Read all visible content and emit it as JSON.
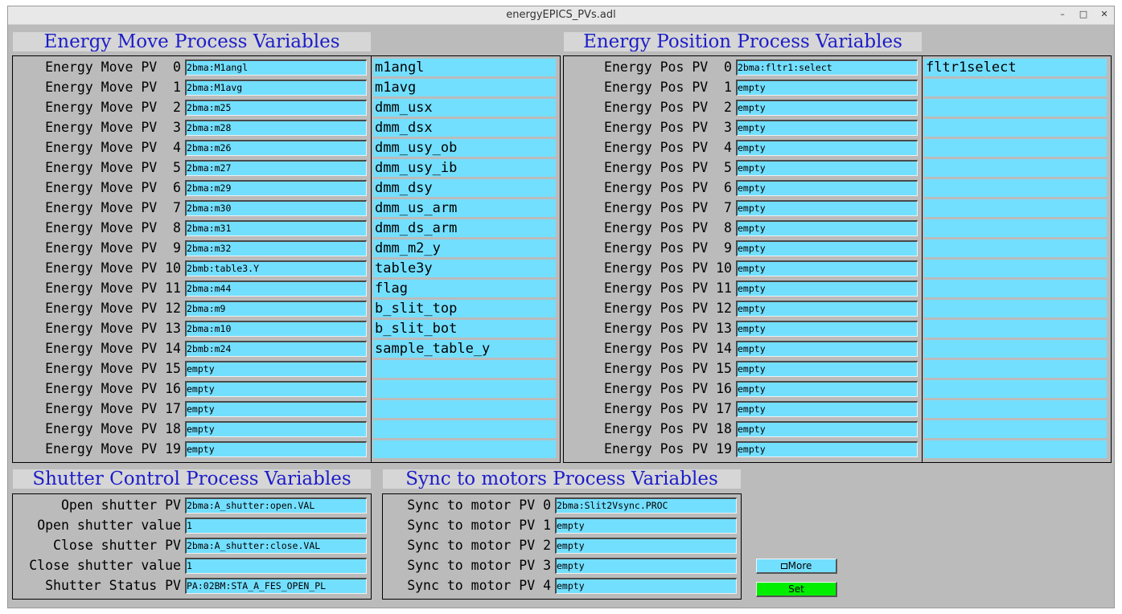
{
  "window": {
    "title": "energyEPICS_PVs.adl",
    "minimize": "–",
    "maximize": "□",
    "close": "✕"
  },
  "move": {
    "title": "Energy Move Process Variables",
    "rows": [
      {
        "label": "Energy Move PV  0",
        "pv": "2bma:M1angl",
        "desc": "m1angl"
      },
      {
        "label": "Energy Move PV  1",
        "pv": "2bma:M1avg",
        "desc": "m1avg"
      },
      {
        "label": "Energy Move PV  2",
        "pv": "2bma:m25",
        "desc": "dmm_usx"
      },
      {
        "label": "Energy Move PV  3",
        "pv": "2bma:m28",
        "desc": "dmm_dsx"
      },
      {
        "label": "Energy Move PV  4",
        "pv": "2bma:m26",
        "desc": "dmm_usy_ob"
      },
      {
        "label": "Energy Move PV  5",
        "pv": "2bma:m27",
        "desc": "dmm_usy_ib"
      },
      {
        "label": "Energy Move PV  6",
        "pv": "2bma:m29",
        "desc": "dmm_dsy"
      },
      {
        "label": "Energy Move PV  7",
        "pv": "2bma:m30",
        "desc": "dmm_us_arm"
      },
      {
        "label": "Energy Move PV  8",
        "pv": "2bma:m31",
        "desc": "dmm_ds_arm"
      },
      {
        "label": "Energy Move PV  9",
        "pv": "2bma:m32",
        "desc": "dmm_m2_y"
      },
      {
        "label": "Energy Move PV 10",
        "pv": "2bmb:table3.Y",
        "desc": "table3y"
      },
      {
        "label": "Energy Move PV 11",
        "pv": "2bma:m44",
        "desc": "flag"
      },
      {
        "label": "Energy Move PV 12",
        "pv": "2bma:m9",
        "desc": "b_slit_top"
      },
      {
        "label": "Energy Move PV 13",
        "pv": "2bma:m10",
        "desc": "b_slit_bot"
      },
      {
        "label": "Energy Move PV 14",
        "pv": "2bmb:m24",
        "desc": "sample_table_y"
      },
      {
        "label": "Energy Move PV 15",
        "pv": "empty",
        "desc": ""
      },
      {
        "label": "Energy Move PV 16",
        "pv": "empty",
        "desc": ""
      },
      {
        "label": "Energy Move PV 17",
        "pv": "empty",
        "desc": ""
      },
      {
        "label": "Energy Move PV 18",
        "pv": "empty",
        "desc": ""
      },
      {
        "label": "Energy Move PV 19",
        "pv": "empty",
        "desc": ""
      }
    ]
  },
  "pos": {
    "title": "Energy Position Process Variables",
    "rows": [
      {
        "label": "Energy Pos PV  0",
        "pv": "2bma:fltr1:select",
        "desc": "fltr1select"
      },
      {
        "label": "Energy Pos PV  1",
        "pv": "empty",
        "desc": ""
      },
      {
        "label": "Energy Pos PV  2",
        "pv": "empty",
        "desc": ""
      },
      {
        "label": "Energy Pos PV  3",
        "pv": "empty",
        "desc": ""
      },
      {
        "label": "Energy Pos PV  4",
        "pv": "empty",
        "desc": ""
      },
      {
        "label": "Energy Pos PV  5",
        "pv": "empty",
        "desc": ""
      },
      {
        "label": "Energy Pos PV  6",
        "pv": "empty",
        "desc": ""
      },
      {
        "label": "Energy Pos PV  7",
        "pv": "empty",
        "desc": ""
      },
      {
        "label": "Energy Pos PV  8",
        "pv": "empty",
        "desc": ""
      },
      {
        "label": "Energy Pos PV  9",
        "pv": "empty",
        "desc": ""
      },
      {
        "label": "Energy Pos PV 10",
        "pv": "empty",
        "desc": ""
      },
      {
        "label": "Energy Pos PV 11",
        "pv": "empty",
        "desc": ""
      },
      {
        "label": "Energy Pos PV 12",
        "pv": "empty",
        "desc": ""
      },
      {
        "label": "Energy Pos PV 13",
        "pv": "empty",
        "desc": ""
      },
      {
        "label": "Energy Pos PV 14",
        "pv": "empty",
        "desc": ""
      },
      {
        "label": "Energy Pos PV 15",
        "pv": "empty",
        "desc": ""
      },
      {
        "label": "Energy Pos PV 16",
        "pv": "empty",
        "desc": ""
      },
      {
        "label": "Energy Pos PV 17",
        "pv": "empty",
        "desc": ""
      },
      {
        "label": "Energy Pos PV 18",
        "pv": "empty",
        "desc": ""
      },
      {
        "label": "Energy Pos PV 19",
        "pv": "empty",
        "desc": ""
      }
    ]
  },
  "shutter": {
    "title": "Shutter Control Process Variables",
    "rows": [
      {
        "label": "Open shutter PV",
        "pv": "2bma:A_shutter:open.VAL"
      },
      {
        "label": "Open shutter value",
        "pv": "1"
      },
      {
        "label": "Close shutter PV",
        "pv": "2bma:A_shutter:close.VAL"
      },
      {
        "label": "Close shutter value",
        "pv": "1"
      },
      {
        "label": "Shutter Status PV",
        "pv": "PA:02BM:STA_A_FES_OPEN_PL"
      }
    ]
  },
  "sync": {
    "title": "Sync to motors Process Variables",
    "rows": [
      {
        "label": "Sync to motor PV 0",
        "pv": "2bma:Slit2Vsync.PROC"
      },
      {
        "label": "Sync to motor PV 1",
        "pv": "empty"
      },
      {
        "label": "Sync to motor PV 2",
        "pv": "empty"
      },
      {
        "label": "Sync to motor PV 3",
        "pv": "empty"
      },
      {
        "label": "Sync to motor PV 4",
        "pv": "empty"
      }
    ]
  },
  "buttons": {
    "more": "More",
    "more_icon": "window-icon",
    "set": "Set"
  },
  "colors": {
    "field": "#73dfff",
    "title_text": "#1d1dc8",
    "set_button": "#00ee00",
    "more_button": "#73dfff",
    "background": "#bbbbbb"
  }
}
